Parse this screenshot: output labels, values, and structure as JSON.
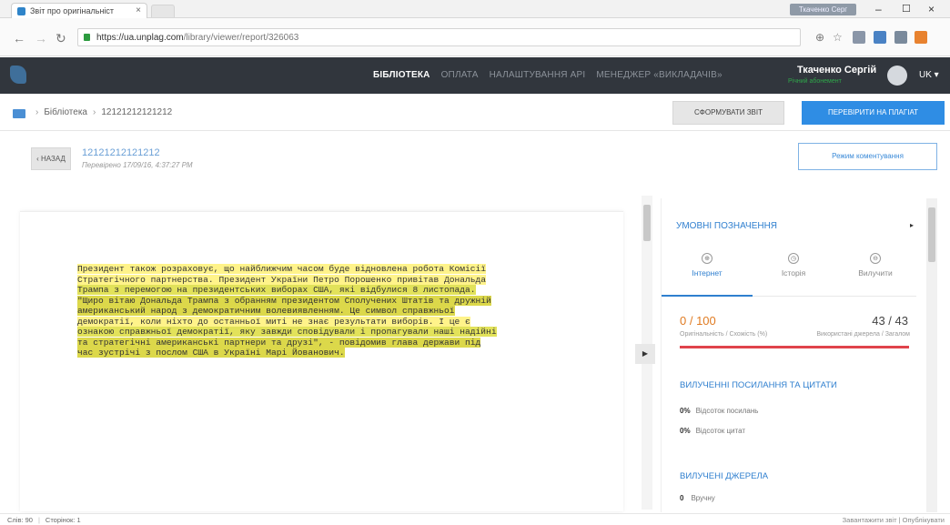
{
  "browser": {
    "tab_title": "Звіт про оригінальніст",
    "tab_close": "×",
    "user_pill": "Ткаченко Серг",
    "url_host": "https://ua.unplag.com",
    "url_path": "/library/viewer/report/326063",
    "win_min": "–",
    "win_max": "☐",
    "win_close": "×"
  },
  "header": {
    "nav": [
      "БІБЛІОТЕКА",
      "ОПЛАТА",
      "НАЛАШТУВАННЯ API",
      "МЕНЕДЖЕР «ВИКЛАДАЧІВ»"
    ],
    "user_name": "Ткаченко Сергій",
    "user_sub": "Річний абонемент",
    "lang": "UK ▾"
  },
  "breadcrumb": {
    "root": "Бібліотека",
    "current": "12121212121212",
    "sep": "›"
  },
  "actions": {
    "generate": "СФОРМУВАТИ ЗВІТ",
    "check": "ПЕРЕВІРИТИ НА ПЛАГІАТ",
    "back": "‹ НАЗАД",
    "comment_mode": "Режим коментування"
  },
  "document": {
    "title": "12121212121212",
    "checked": "Перевірено 17/09/16, 4:37:27 PM",
    "lines": [
      "Президент також розраховує, що найближчим часом буде відновлена робота Комісії",
      "Стратегічного партнерства. Президент України Петро Порошенко привітав Дональда",
      "Трампа з перемогою на президентських виборах США, які відбулися 8 листопада.",
      "\"Щиро вітаю Дональда Трампа з обранням президентом Сполучених Штатів та дружній",
      "американський народ з демократичним волевиявленням. Це символ справжньої",
      "демократії, коли ніхто до останньої миті не знає результати виборів. І це є",
      "ознакою справжньої демократії, яку завжди сповідували і пропагували наші надійні",
      "та стратегічні американські партнери та друзі\", - повідомив глава держави під",
      "час зустрічі з послом США в Україні Марі Йованович."
    ]
  },
  "panel": {
    "legend_title": "УМОВНІ ПОЗНАЧЕННЯ",
    "legend_arrow": "▸",
    "tabs": [
      {
        "label": "Інтернет",
        "icon": "globe-icon",
        "glyph": "⊕"
      },
      {
        "label": "Історія",
        "icon": "clock-icon",
        "glyph": "◷"
      },
      {
        "label": "Вилучити",
        "icon": "excluded-icon",
        "glyph": "⊖"
      }
    ],
    "score": "0 / 100",
    "score_label": "Оригінальність / Схожість (%)",
    "sources": "43 / 43",
    "sources_label": "Використані джерела / Загалом",
    "excluded_title": "ВИЛУЧЕННІ ПОСИЛАННЯ ТА ЦИТАТИ",
    "ref_pct": "0%",
    "ref_label": "Відсоток посилань",
    "quote_pct": "0%",
    "quote_label": "Відсоток цитат",
    "excluded_sources_title": "ВИЛУЧЕНІ ДЖЕРЕЛА",
    "manual_count": "0",
    "manual_label": "Вручну"
  },
  "status": {
    "words": "Слів: 90",
    "pages": "Сторінок: 1",
    "right": "Завантажити звіт  |  Опублікувати"
  },
  "colors": {
    "accent": "#2f8de4",
    "header_bg": "#31363d",
    "highlight": "#fff38a",
    "score": "#e07b22",
    "bar": "#e0434b"
  }
}
